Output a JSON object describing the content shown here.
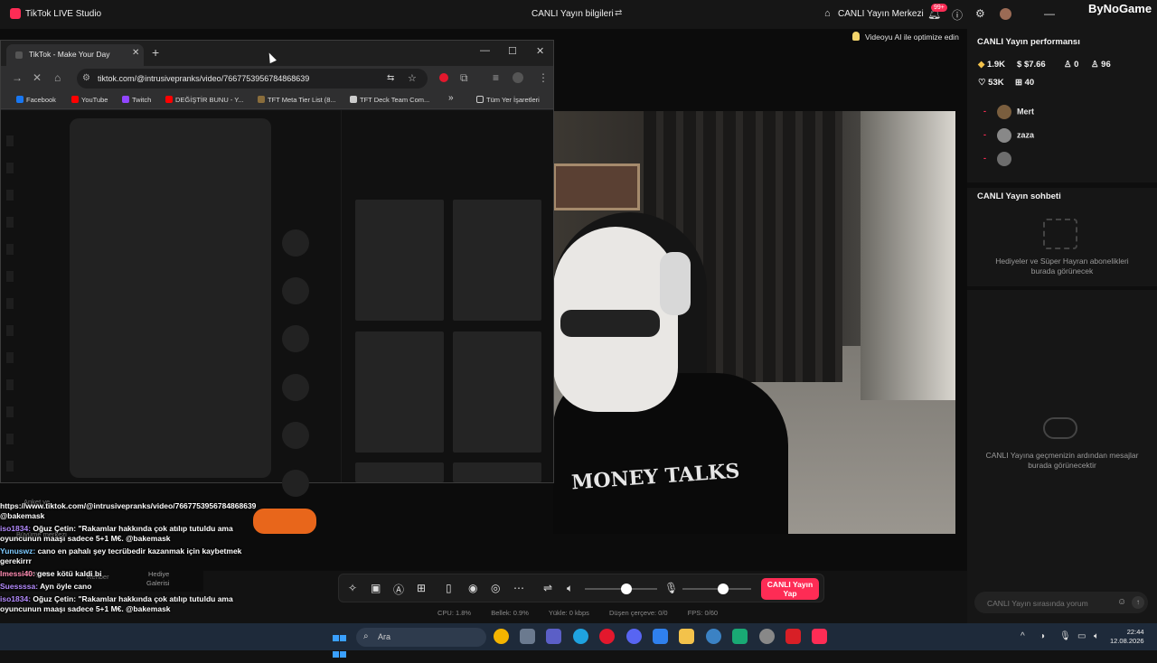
{
  "titlebar": {
    "app_title": "TikTok LIVE Studio",
    "center_title": "CANLI Yayın bilgileri",
    "live_center": "CANLI Yayın Merkezi",
    "notif_badge": "99+",
    "watermark": "ByNoGame"
  },
  "stage": {
    "ai_tip": "Videoyu AI ile optimize edin",
    "shirt_text": "MONEY TALKS"
  },
  "browser": {
    "tab_label": "TikTok - Make Your Day",
    "url": "tiktok.com/@intrusivepranks/video/7667753956784868639",
    "bookmarks": [
      {
        "label": "Facebook",
        "color": "#1877f2"
      },
      {
        "label": "YouTube",
        "color": "#ff0000"
      },
      {
        "label": "Twitch",
        "color": "#9146ff"
      },
      {
        "label": "DEĞİŞTİR BUNU - Y...",
        "color": "#ff0000"
      },
      {
        "label": "TFT Meta Tier List (8...",
        "color": "#8a6d3b"
      },
      {
        "label": "TFT Deck Team Com...",
        "color": "#cccccc"
      }
    ],
    "bookmarks_more": "»",
    "all_bookmarks": "Tüm Yer İşaretleri"
  },
  "panel": {
    "perf_title": "CANLI Yayın performansı",
    "stats": {
      "diamonds": "1.9K",
      "earnings": "$7.66",
      "followers": "0",
      "new_viewers": "96",
      "likes": "53K",
      "gifts": "40"
    },
    "viewers": [
      {
        "name": "Mert"
      },
      {
        "name": "zaza"
      },
      {
        "name": ""
      }
    ],
    "chat_title": "CANLI Yayın sohbeti",
    "gift_message": "Hediyeler ve Süper Hayran abonelikleri burada görünecek",
    "msg_message": "CANLI Yayına geçmenizin ardından mesajlar burada görünecektir",
    "comment_placeholder": "CANLI Yayın sırasında yorum"
  },
  "controls": {
    "go_live": "CANLI Yayın Yap",
    "cpu": "CPU: 1.8%",
    "memory": "Bellek: 0.9%",
    "upload": "Yükle: 0 kbps",
    "dropped": "Düşen çerçeve: 0/0",
    "fps": "FPS: 0/60"
  },
  "overlay": {
    "ghost_poll": "Anket ve",
    "ghost_grow": "Büyüme merkezi",
    "ghost_fans": "Hayran",
    "ghost_guide": "Rehber",
    "ghost_gallery_1": "Hediye",
    "ghost_gallery_2": "Galerisi",
    "lines": [
      {
        "user": "",
        "text": "https://www.tiktok.com/@intrusivepranks/video/7667753956784868639 @bakemask"
      },
      {
        "user": "iso1834:",
        "text": "Oğuz Çetin: \"Rakamlar hakkında çok atılıp tutuldu ama oyuncunun maaşı sadece 5+1 M€. @bakemask"
      },
      {
        "user": "Yunuswz:",
        "text": "cano en pahalı şey tecrübedir kazanmak için kaybetmek gerekirrr"
      },
      {
        "user": "Imessi40:",
        "text": "gese kötü kaldi bi"
      },
      {
        "user": "Suessssa:",
        "text": "Ayn öyle cano"
      },
      {
        "user": "iso1834:",
        "text": "Oğuz Çetin: \"Rakamlar hakkında çok atılıp tutuldu ama oyuncunun maaşı sadece 5+1 M€. @bakemask"
      }
    ]
  },
  "taskbar": {
    "search_placeholder": "Ara",
    "time": "22:44",
    "date": "12.08.2026"
  }
}
